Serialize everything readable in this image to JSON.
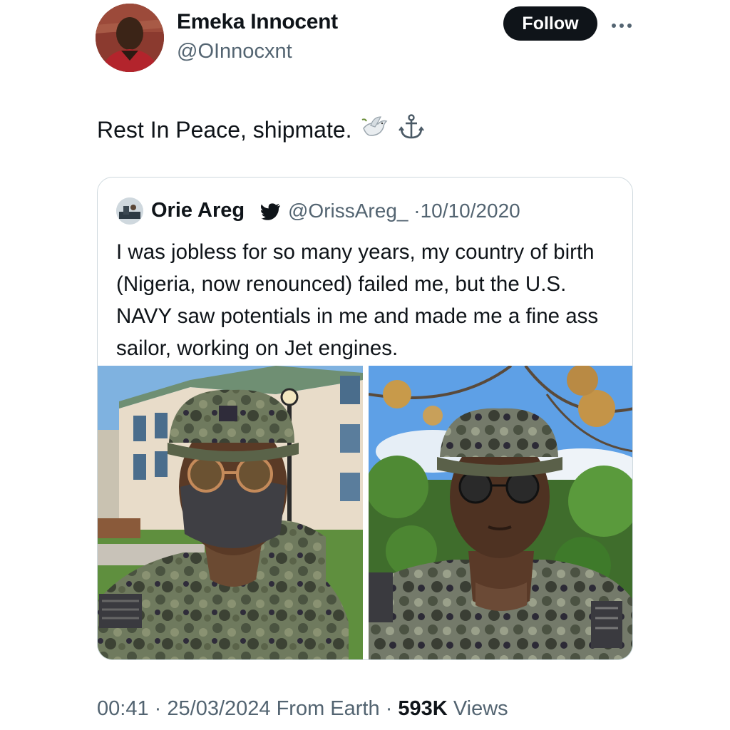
{
  "author": {
    "display_name": "Emeka Innocent",
    "handle": "@OInnocxnt",
    "avatar_icon": "profile-photo"
  },
  "follow_label": "Follow",
  "more_icon": "ellipsis-icon",
  "tweet": {
    "text": "Rest In Peace, shipmate.",
    "emojis": [
      "dove-emoji",
      "anchor-emoji"
    ]
  },
  "quoted": {
    "display_name": "Orie Areg",
    "verified_icon": "twitter-bird-icon",
    "handle": "@OrissAreg_",
    "separator": "·",
    "date": "10/10/2020",
    "text": "I was jobless for so many years, my country of birth (Nigeria, now renounced) failed me, but the U.S. NAVY saw potentials in me and made me a fine ass sailor, working on Jet engines.",
    "photos": [
      "sailor-photo-masked",
      "sailor-photo-outdoor"
    ]
  },
  "footer": {
    "time": "00:41",
    "sep1": "·",
    "date": "25/03/2024",
    "source": "From Earth",
    "sep2": "·",
    "views_count": "593K",
    "views_label": "Views"
  },
  "colors": {
    "text": "#0f1419",
    "secondary": "#536471",
    "border": "#cfd9de",
    "follow_bg": "#0f1419"
  }
}
